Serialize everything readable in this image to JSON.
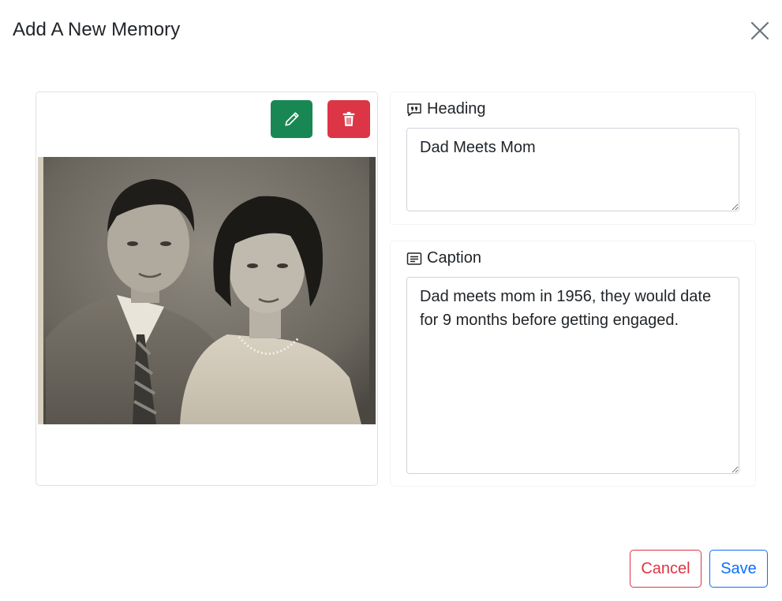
{
  "modal": {
    "title": "Add A New Memory",
    "close_icon": "close-icon"
  },
  "photo": {
    "edit_icon": "pencil-icon",
    "delete_icon": "trash-icon",
    "edit_color": "#198754",
    "delete_color": "#dc3545"
  },
  "heading": {
    "label": "Heading",
    "icon": "quote-icon",
    "value": "Dad Meets Mom"
  },
  "caption": {
    "label": "Caption",
    "icon": "text-lines-icon",
    "value": "Dad meets mom in 1956, they would date for 9 months before getting engaged."
  },
  "footer": {
    "cancel_label": "Cancel",
    "save_label": "Save",
    "cancel_color": "#dc3545",
    "save_color": "#0d6efd"
  }
}
